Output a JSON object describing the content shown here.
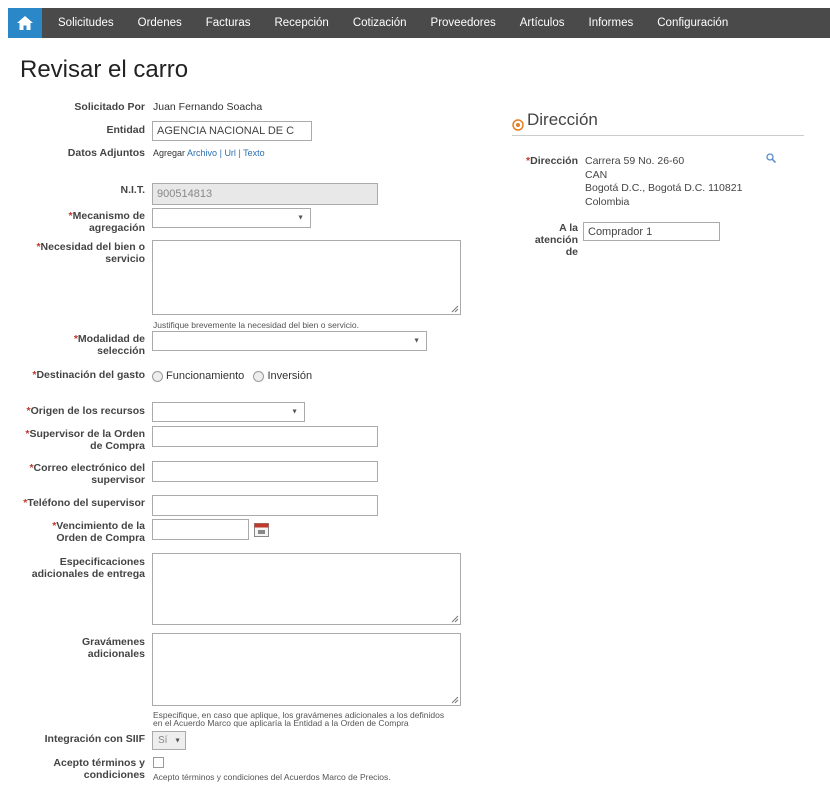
{
  "nav": {
    "home_icon": "home-icon",
    "items": [
      "Solicitudes",
      "Ordenes",
      "Facturas",
      "Recepción",
      "Cotización",
      "Proveedores",
      "Artículos",
      "Informes",
      "Configuración"
    ]
  },
  "page_title": "Revisar el carro",
  "form": {
    "solicitado_por": {
      "label": "Solicitado Por",
      "value": "Juan Fernando Soacha"
    },
    "entidad": {
      "label": "Entidad",
      "value": "AGENCIA NACIONAL DE C"
    },
    "datos_adjuntos": {
      "label": "Datos Adjuntos",
      "prefix": "Agregar",
      "archivo": "Archivo",
      "sep1": "|",
      "url": "Url",
      "sep2": "|",
      "texto": "Texto"
    },
    "nit": {
      "label": "N.I.T.",
      "value": "900514813"
    },
    "mecanismo": {
      "label": "Mecanismo de agregación",
      "value": ""
    },
    "necesidad": {
      "label": "Necesidad del bien o servicio",
      "hint": "Justifique brevemente la necesidad del bien o servicio."
    },
    "modalidad": {
      "label": "Modalidad de selección",
      "value": ""
    },
    "destinacion": {
      "label": "Destinación del gasto",
      "opt1": "Funcionamiento",
      "opt2": "Inversión"
    },
    "origen": {
      "label": "Origen de los recursos",
      "value": ""
    },
    "supervisor": {
      "label": "Supervisor de la Orden de Compra",
      "value": ""
    },
    "correo": {
      "label": "Correo electrónico del supervisor",
      "value": ""
    },
    "telefono": {
      "label": "Teléfono del supervisor",
      "value": ""
    },
    "vencimiento": {
      "label": "Vencimiento de la Orden de Compra",
      "value": ""
    },
    "especificaciones": {
      "label": "Especificaciones adicionales de entrega"
    },
    "gravamenes": {
      "label": "Gravámenes adicionales",
      "hint1": "Especifique, en caso que aplique, los gravámenes adicionales a los definidos",
      "hint2": "en el Acuerdo Marco que aplicaría la Entidad a la Orden de Compra"
    },
    "siif": {
      "label": "Integración con SIIF",
      "value": "Sí"
    },
    "terminos": {
      "label": "Acepto términos y condiciones",
      "text": "Acepto términos y condiciones del Acuerdos Marco de Precios."
    }
  },
  "direccion": {
    "title": "Dirección",
    "label": "Dirección",
    "line1": "Carrera 59 No. 26-60",
    "line2": "CAN",
    "line3": "Bogotá D.C., Bogotá D.C. 110821",
    "line4": "Colombia",
    "atencion_label": "A la atención de",
    "atencion_value": "Comprador 1"
  }
}
